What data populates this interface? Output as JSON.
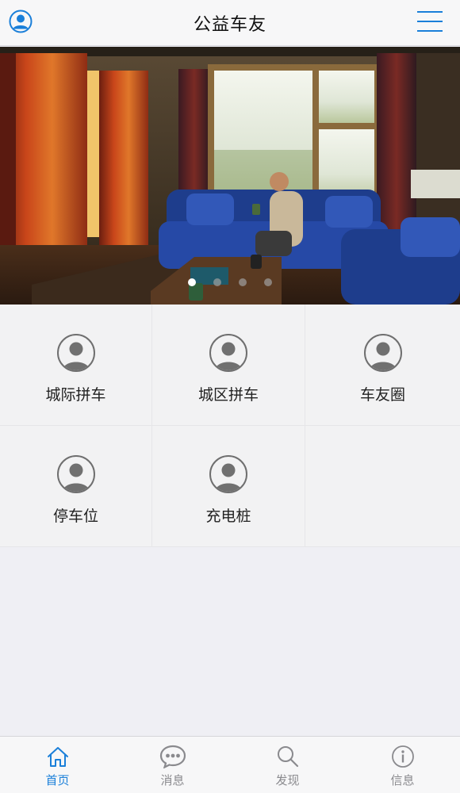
{
  "header": {
    "title": "公益车友",
    "left_icon": "user-circle-icon",
    "right_icon": "menu-icon"
  },
  "banner": {
    "slides_count": 4,
    "active_index": 0
  },
  "grid": {
    "items": [
      {
        "label": "城际拼车",
        "icon": "avatar-icon"
      },
      {
        "label": "城区拼车",
        "icon": "avatar-icon"
      },
      {
        "label": "车友圈",
        "icon": "avatar-icon"
      },
      {
        "label": "停车位",
        "icon": "avatar-icon"
      },
      {
        "label": "充电桩",
        "icon": "avatar-icon"
      }
    ]
  },
  "tabbar": {
    "tabs": [
      {
        "label": "首页",
        "icon": "home-icon",
        "active": true
      },
      {
        "label": "消息",
        "icon": "chat-icon",
        "active": false
      },
      {
        "label": "发现",
        "icon": "search-icon",
        "active": false
      },
      {
        "label": "信息",
        "icon": "info-icon",
        "active": false
      }
    ]
  },
  "colors": {
    "accent": "#1a7fd9",
    "inactive": "#8a8a8e",
    "background": "#efeff4"
  }
}
